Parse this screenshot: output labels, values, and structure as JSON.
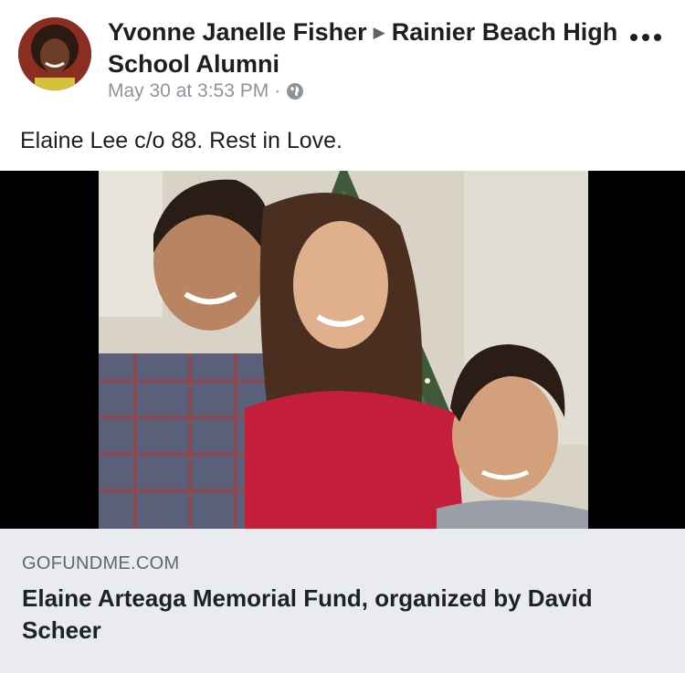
{
  "post": {
    "author": "Yvonne Janelle Fisher",
    "group": "Rainier Beach High School Alumni",
    "timestamp": "May 30 at 3:53 PM",
    "separator": "·",
    "privacy_icon": "globe-icon",
    "text": "Elaine Lee c/o 88. Rest in Love."
  },
  "link_preview": {
    "domain": "GOFUNDME.COM",
    "title": "Elaine Arteaga Memorial Fund, organized by David Scheer"
  },
  "colors": {
    "link_card_bg": "#e9ebee",
    "meta_text": "#8d949e",
    "primary_text": "#1c1e21"
  }
}
